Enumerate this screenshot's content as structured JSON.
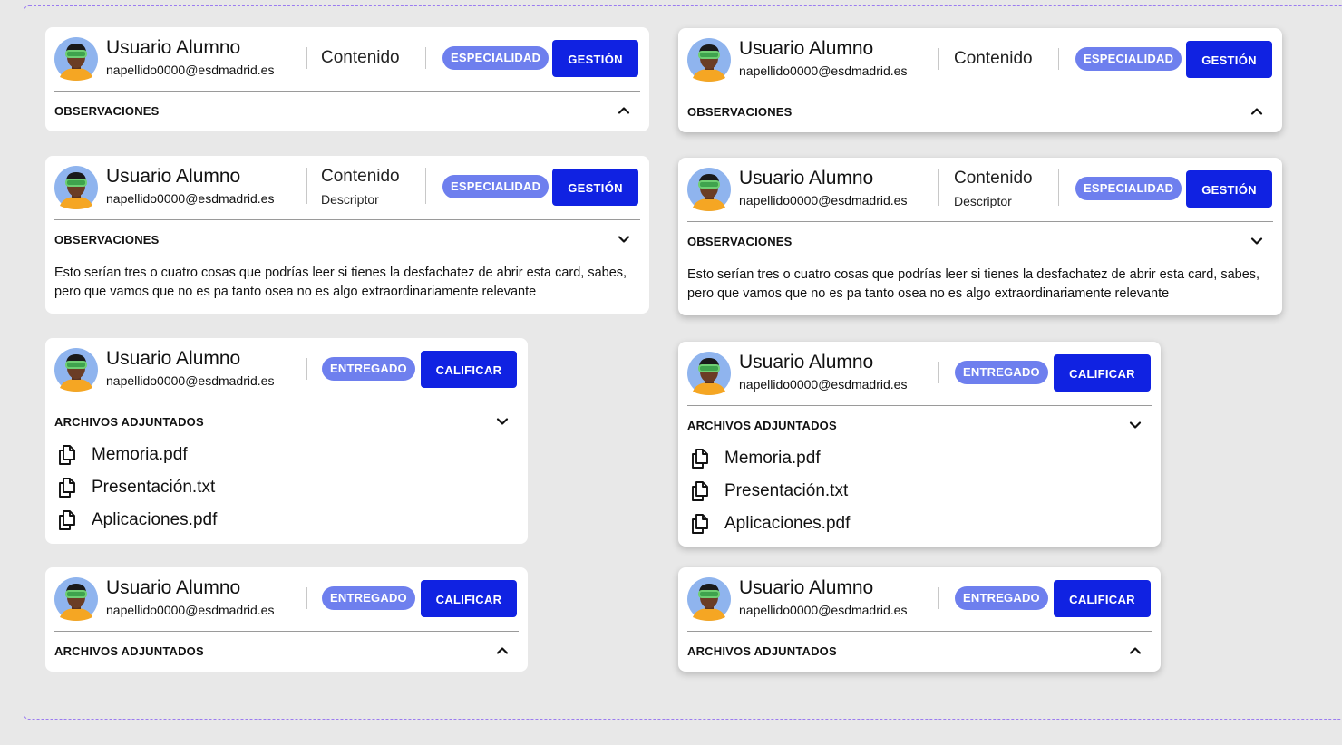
{
  "user": {
    "name": "Usuario Alumno",
    "email": "napellido0000@esdmadrid.es"
  },
  "labels": {
    "contenido": "Contenido",
    "descriptor": "Descriptor",
    "especialidad": "ESPECIALIDAD",
    "gestion": "GESTIÓN",
    "entregado": "ENTREGADO",
    "calificar": "CALIFICAR",
    "observaciones": "OBSERVACIONES",
    "archivos": "ARCHIVOS ADJUNTADOS"
  },
  "observaciones_text": "Esto serían tres o cuatro cosas que podrías leer si tienes la desfachatez de abrir esta card, sabes, pero que vamos que no es pa tanto osea no es algo extraordinariamente relevante",
  "files": [
    "Memoria.pdf",
    "Presentación.txt",
    "Aplicaciones.pdf"
  ],
  "colors": {
    "primary_button": "#1022e2",
    "pill": "#6e7fee",
    "background": "#e8e8e8",
    "frame_dashed": "#9b7cf0"
  },
  "icons": {
    "avatar": "avatar-vr-headset",
    "chevron_up": "chevron-up-icon",
    "chevron_down": "chevron-down-icon",
    "file": "file-copy-icon"
  }
}
